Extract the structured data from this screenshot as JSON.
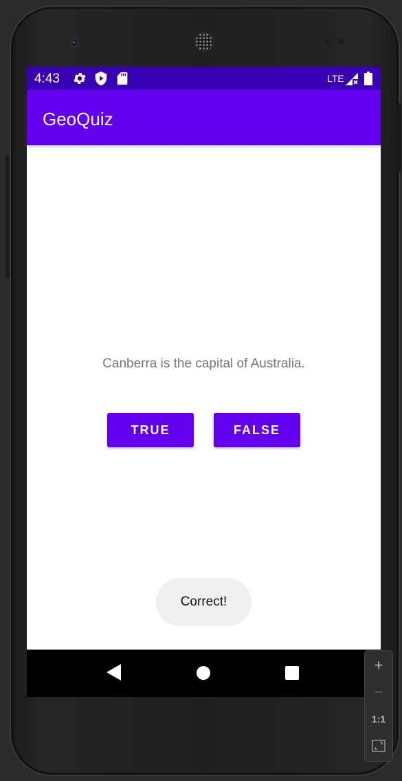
{
  "status_bar": {
    "time": "4:43",
    "icons": [
      "settings-icon",
      "play-protect-icon",
      "sd-card-icon"
    ],
    "network": "LTE",
    "signal_icon": "signal-no-data-icon",
    "battery_icon": "battery-full-icon"
  },
  "app_bar": {
    "title": "GeoQuiz"
  },
  "question": {
    "text": "Canberra is the capital of Australia."
  },
  "buttons": {
    "true_label": "TRUE",
    "false_label": "FALSE"
  },
  "toast": {
    "text": "Correct!"
  },
  "nav_bar": {
    "icons": [
      "back-icon",
      "home-icon",
      "recents-icon"
    ]
  },
  "emulator_controls": {
    "zoom_in": "+",
    "zoom_out": "−",
    "one_to_one": "1:1",
    "fit_icon": "fit-to-window-icon"
  },
  "colors": {
    "status_bar": "#3700b3",
    "primary": "#6200ee",
    "question_text": "#757575",
    "toast_bg": "#efefef"
  }
}
